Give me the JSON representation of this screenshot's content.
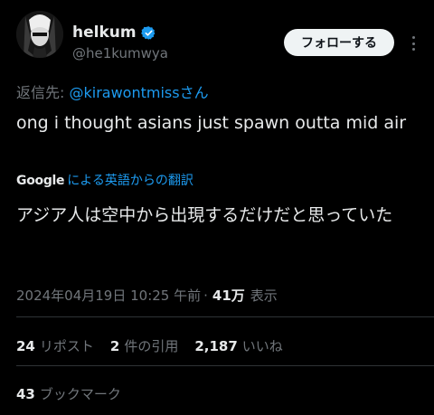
{
  "author": {
    "display_name": "helkum",
    "handle": "@he1kumwya",
    "verified": true
  },
  "follow_button": {
    "label": "フォローする"
  },
  "reply": {
    "prefix": "返信先: ",
    "mention": "@kirawontmiss",
    "suffix": "さん"
  },
  "tweet": {
    "text": "ong i thought asians just spawn outta mid air"
  },
  "translation": {
    "provider": "Google",
    "link_label": "による英語からの翻訳",
    "text": "アジア人は空中から出現するだけだと思っていた"
  },
  "meta": {
    "timestamp": "2024年04月19日 10:25 午前",
    "separator": "·",
    "views_count": "41万",
    "views_label": "表示"
  },
  "stats": {
    "reposts_count": "24",
    "reposts_label": "リポスト",
    "quotes_count": "2",
    "quotes_label": "件の引用",
    "likes_count": "2,187",
    "likes_label": "いいね",
    "bookmarks_count": "43",
    "bookmarks_label": "ブックマーク"
  },
  "colors": {
    "background": "#000000",
    "text_primary": "#e7e9ea",
    "text_secondary": "#71767b",
    "accent": "#1d9bf0",
    "divider": "#2f3336"
  }
}
